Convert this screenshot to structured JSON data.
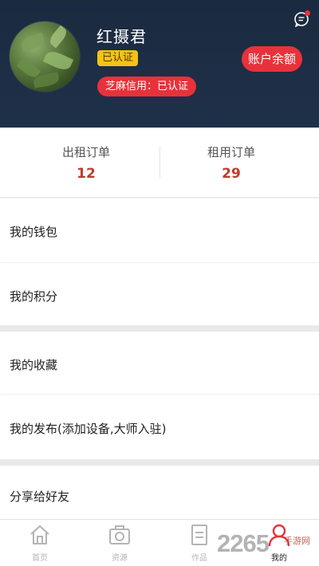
{
  "profile": {
    "username": "红摄君",
    "verified_label": "已认证",
    "credit_label": "芝麻信用：已认证",
    "balance_button": "账户余额",
    "message_icon": "chat-bubble-icon"
  },
  "orders": [
    {
      "label": "出租订单",
      "count": "12"
    },
    {
      "label": "租用订单",
      "count": "29"
    }
  ],
  "menu": {
    "group1": [
      "我的钱包",
      "我的积分"
    ],
    "group2": [
      "我的收藏",
      "我的发布(添加设备,大师入驻)"
    ],
    "group3": [
      "分享给好友"
    ]
  },
  "tabbar": [
    {
      "label": "首页",
      "icon": "home-icon",
      "active": false
    },
    {
      "label": "资源",
      "icon": "camera-icon",
      "active": false
    },
    {
      "label": "作品",
      "icon": "document-icon",
      "active": false
    },
    {
      "label": "我的",
      "icon": "person-icon",
      "active": true
    }
  ],
  "watermark": {
    "text": "2265",
    "sub": "手游网"
  },
  "colors": {
    "accent": "#e8323b",
    "header": "#1d2e45",
    "badge": "#f3c318",
    "count": "#c0392b"
  }
}
